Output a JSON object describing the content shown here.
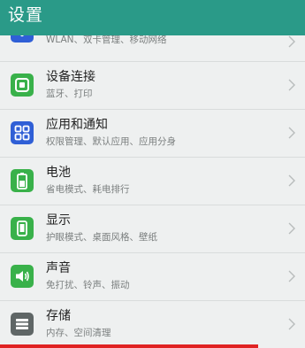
{
  "header": {
    "title": "设置"
  },
  "colors": {
    "header_bg": "#2a9a88",
    "icon_blue": "#2f5fd6",
    "icon_green": "#39b14a",
    "icon_gray": "#5f6666",
    "selection_underline": "#e02222"
  },
  "rows": [
    {
      "subtitle": "WLAN、双卡管理、移动网络",
      "icon": "network-icon"
    },
    {
      "title": "设备连接",
      "subtitle": "蓝牙、打印",
      "icon": "device-connection-icon"
    },
    {
      "title": "应用和通知",
      "subtitle": "权限管理、默认应用、应用分身",
      "icon": "apps-icon"
    },
    {
      "title": "电池",
      "subtitle": "省电模式、耗电排行",
      "icon": "battery-icon"
    },
    {
      "title": "显示",
      "subtitle": "护眼模式、桌面风格、壁纸",
      "icon": "display-icon"
    },
    {
      "title": "声音",
      "subtitle": "免打扰、铃声、振动",
      "icon": "sound-icon"
    },
    {
      "title": "存储",
      "subtitle": "内存、空间清理",
      "icon": "storage-icon"
    }
  ]
}
